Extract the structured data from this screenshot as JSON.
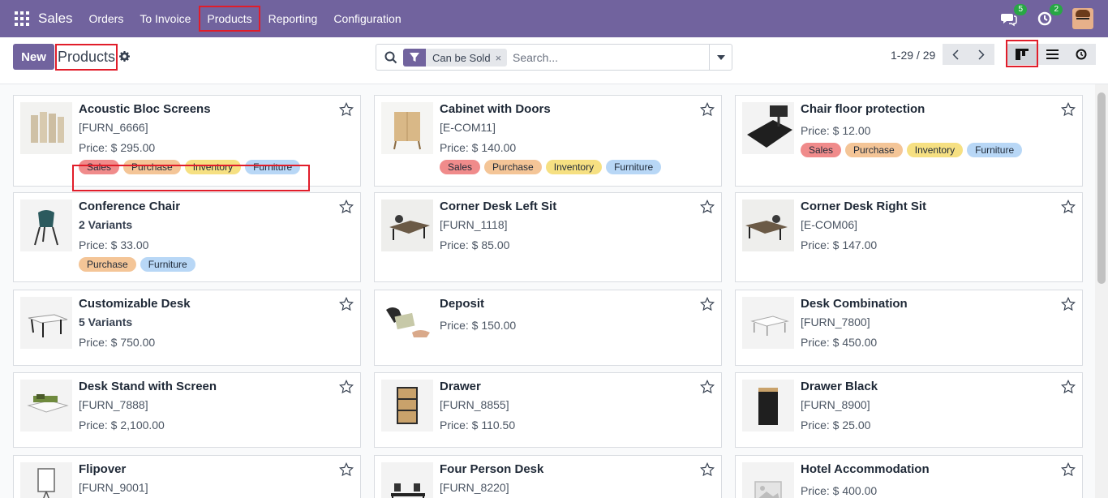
{
  "app": {
    "brand": "Sales"
  },
  "nav": {
    "items": [
      "Orders",
      "To Invoice",
      "Products",
      "Reporting",
      "Configuration"
    ]
  },
  "systray": {
    "messages_count": "5",
    "activities_count": "2"
  },
  "control": {
    "new_label": "New",
    "title": "Products"
  },
  "search": {
    "facet": "Can be Sold",
    "facet_remove": "×",
    "placeholder": "Search..."
  },
  "pager": {
    "value": "1-29 / 29"
  },
  "products": [
    {
      "name": "Acoustic Bloc Screens",
      "line2": "[FURN_6666]",
      "price": "Price: $ 295.00",
      "tags": [
        "Sales",
        "Purchase",
        "Inventory",
        "Furniture"
      ]
    },
    {
      "name": "Cabinet with Doors",
      "line2": "[E-COM11]",
      "price": "Price: $ 140.00",
      "tags": [
        "Sales",
        "Purchase",
        "Inventory",
        "Furniture"
      ]
    },
    {
      "name": "Chair floor protection",
      "line2": "",
      "price": "Price: $ 12.00",
      "tags": [
        "Sales",
        "Purchase",
        "Inventory",
        "Furniture"
      ]
    },
    {
      "name": "Conference Chair",
      "line2": "2 Variants",
      "price": "Price: $ 33.00",
      "tags": [
        "Purchase",
        "Furniture"
      ]
    },
    {
      "name": "Corner Desk Left Sit",
      "line2": "[FURN_1118]",
      "price": "Price: $ 85.00",
      "tags": []
    },
    {
      "name": "Corner Desk Right Sit",
      "line2": "[E-COM06]",
      "price": "Price: $ 147.00",
      "tags": []
    },
    {
      "name": "Customizable Desk",
      "line2": "5 Variants",
      "price": "Price: $ 750.00",
      "tags": []
    },
    {
      "name": "Deposit",
      "line2": "",
      "price": "Price: $ 150.00",
      "tags": []
    },
    {
      "name": "Desk Combination",
      "line2": "[FURN_7800]",
      "price": "Price: $ 450.00",
      "tags": []
    },
    {
      "name": "Desk Stand with Screen",
      "line2": "[FURN_7888]",
      "price": "Price: $ 2,100.00",
      "tags": []
    },
    {
      "name": "Drawer",
      "line2": "[FURN_8855]",
      "price": "Price: $ 110.50",
      "tags": []
    },
    {
      "name": "Drawer Black",
      "line2": "[FURN_8900]",
      "price": "Price: $ 25.00",
      "tags": []
    },
    {
      "name": "Flipover",
      "line2": "[FURN_9001]",
      "price": "",
      "tags": []
    },
    {
      "name": "Four Person Desk",
      "line2": "[FURN_8220]",
      "price": "",
      "tags": []
    },
    {
      "name": "Hotel Accommodation",
      "line2": "",
      "price": "Price: $ 400.00",
      "tags": []
    }
  ]
}
